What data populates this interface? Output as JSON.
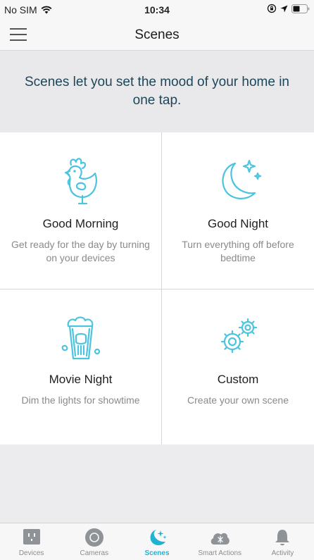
{
  "status_bar": {
    "carrier": "No SIM",
    "time": "10:34"
  },
  "nav": {
    "title": "Scenes"
  },
  "intro": {
    "text": "Scenes let you set the mood of your home in one tap."
  },
  "scenes": [
    {
      "name": "Good Morning",
      "description": "Get ready for the day by turning on your devices",
      "icon": "rooster-icon"
    },
    {
      "name": "Good Night",
      "description": "Turn everything off before bedtime",
      "icon": "moon-stars-icon"
    },
    {
      "name": "Movie Night",
      "description": "Dim the lights for showtime",
      "icon": "popcorn-icon"
    },
    {
      "name": "Custom",
      "description": "Create your own scene",
      "icon": "gears-icon"
    }
  ],
  "tabs": [
    {
      "label": "Devices",
      "icon": "plug-icon",
      "active": false
    },
    {
      "label": "Cameras",
      "icon": "camera-lens-icon",
      "active": false
    },
    {
      "label": "Scenes",
      "icon": "moon-sparkle-icon",
      "active": true
    },
    {
      "label": "Smart Actions",
      "icon": "cloud-sparkle-icon",
      "active": false
    },
    {
      "label": "Activity",
      "icon": "bell-icon",
      "active": false
    }
  ],
  "colors": {
    "accent": "#1eb3d2",
    "icon_line": "#4cc3df",
    "intro_text": "#1d4658",
    "inactive_icon": "#8f9398"
  }
}
